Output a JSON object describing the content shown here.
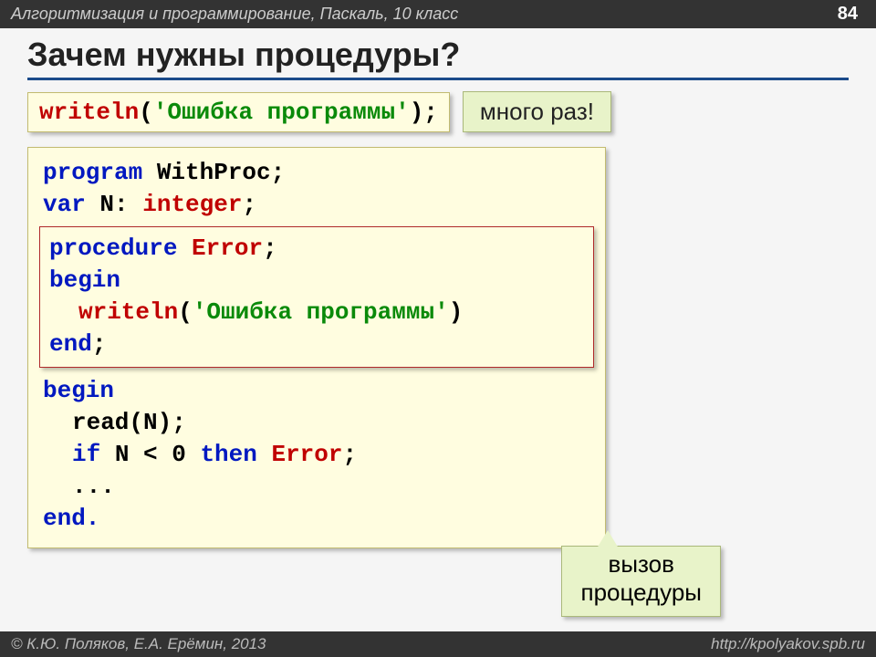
{
  "header": {
    "course": "Алгоритмизация и программирование, Паскаль, 10 класс",
    "page": "84"
  },
  "title": "Зачем нужны процедуры?",
  "snippet": {
    "writeln": "writeln",
    "open": "(",
    "str": "'Ошибка программы'",
    "close": ");"
  },
  "callout_top": "много раз!",
  "code": {
    "l1_program": "program",
    "l1_name": " WithProc;",
    "l2_var": "var",
    "l2_rest": " N: ",
    "l2_type": "integer",
    "l2_semi": ";",
    "proc": {
      "p1_procedure": "procedure",
      "p1_name": " Error",
      "p1_semi": ";",
      "p2_begin": "begin",
      "p3_writeln": "writeln",
      "p3_open": "(",
      "p3_str": "'Ошибка программы'",
      "p3_close": ")",
      "p4_end": "end",
      "p4_semi": ";"
    },
    "b1_begin": "begin",
    "b2_read": "read(N);",
    "b3_if": "if",
    "b3_cond": " N < ",
    "b3_zero": "0",
    "b3_then": " then ",
    "b3_error": "Error",
    "b3_semi": ";",
    "b4_dots": "...",
    "b5_end": "end."
  },
  "callout_bottom": {
    "line1": "вызов",
    "line2": "процедуры"
  },
  "footer": {
    "copyright": "© К.Ю. Поляков, Е.А. Ерёмин, 2013",
    "url": "http://kpolyakov.spb.ru"
  }
}
